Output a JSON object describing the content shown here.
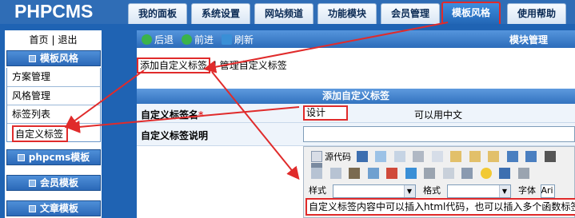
{
  "app": {
    "logo": "PHPCMS"
  },
  "tabs": [
    {
      "label": "我的面板"
    },
    {
      "label": "系统设置"
    },
    {
      "label": "网站频道"
    },
    {
      "label": "功能模块"
    },
    {
      "label": "会员管理"
    },
    {
      "label": "模板风格",
      "active": true
    },
    {
      "label": "使用帮助"
    }
  ],
  "sidebar": {
    "home": "首页",
    "sep": "|",
    "logout": "退出",
    "section_active": "模板风格",
    "items": [
      "方案管理",
      "风格管理",
      "标签列表",
      "自定义标签"
    ],
    "sections": [
      "phpcms模板",
      "会员模板",
      "文章模板"
    ]
  },
  "toolbar": {
    "back": "后退",
    "forward": "前进",
    "refresh": "刷新",
    "title": "模块管理"
  },
  "sublinks": {
    "add": "添加自定义标签",
    "sep": "|",
    "manage": "管理自定义标签"
  },
  "form": {
    "title": "添加自定义标签",
    "name_label": "自定义标签名",
    "required_mark": "*",
    "name_value": "设计",
    "name_hint": "可以用中文",
    "desc_label": "自定义标签说明"
  },
  "editor": {
    "source": "源代码",
    "style_label": "样式",
    "format_label": "格式",
    "font_label": "字体",
    "font_value": "Ari",
    "content": "自定义标签内容中可以插入html代码，也可以插入多个函数标签"
  },
  "colors": {
    "accent_red": "#e02b2b",
    "nav_blue": "#2f6db6",
    "panel_blue": "#1f63b3"
  }
}
